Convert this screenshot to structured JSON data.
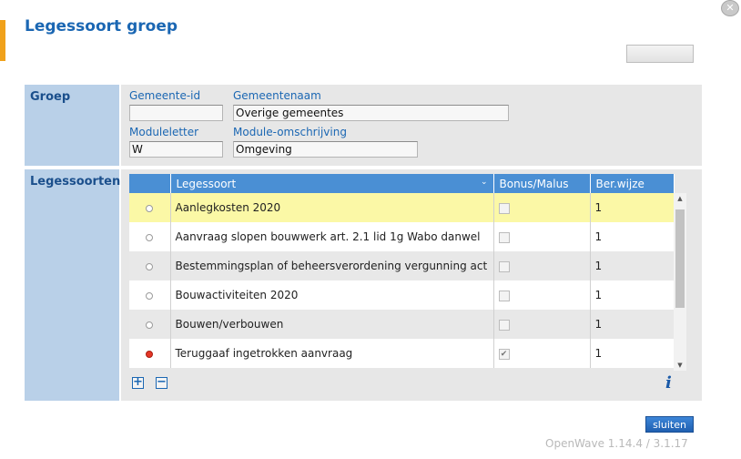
{
  "dialog": {
    "title": "Legessoort groep",
    "close_symbol": "✕"
  },
  "groep": {
    "section_label": "Groep",
    "gemeente_id_label": "Gemeente-id",
    "gemeente_id_value": "",
    "gemeentenaam_label": "Gemeentenaam",
    "gemeentenaam_value": "Overige gemeentes",
    "moduleletter_label": "Moduleletter",
    "moduleletter_value": "W",
    "module_omschrijving_label": "Module-omschrijving",
    "module_omschrijving_value": "Omgeving"
  },
  "legessoorten": {
    "section_label": "Legessoorten",
    "columns": [
      "",
      "Legessoort",
      "Bonus/Malus",
      "Ber.wijze"
    ],
    "rows": [
      {
        "legessoort": "Aanlegkosten 2020",
        "bonus_malus": false,
        "ber_wijze": "1",
        "active": false,
        "selected": true
      },
      {
        "legessoort": "Aanvraag slopen bouwwerk art. 2.1 lid 1g Wabo danwel",
        "bonus_malus": false,
        "ber_wijze": "1",
        "active": false,
        "selected": false
      },
      {
        "legessoort": "Bestemmingsplan of beheersverordening vergunning act",
        "bonus_malus": false,
        "ber_wijze": "1",
        "active": false,
        "selected": false
      },
      {
        "legessoort": "Bouwactiviteiten 2020",
        "bonus_malus": false,
        "ber_wijze": "1",
        "active": false,
        "selected": false
      },
      {
        "legessoort": "Bouwen/verbouwen",
        "bonus_malus": false,
        "ber_wijze": "1",
        "active": false,
        "selected": false
      },
      {
        "legessoort": "Teruggaaf ingetrokken aanvraag",
        "bonus_malus": true,
        "ber_wijze": "1",
        "active": true,
        "selected": false
      }
    ],
    "add_symbol": "+",
    "remove_symbol": "−",
    "info_symbol": "i"
  },
  "footer": {
    "close_label": "sluiten",
    "version": "OpenWave 1.14.4 / 3.1.17"
  },
  "colors": {
    "accent": "#f0a11b",
    "header_blue": "#4a8fd4",
    "title_blue": "#1b67b3",
    "selected_row": "#fbf8a6",
    "active_dot": "#e53626"
  }
}
